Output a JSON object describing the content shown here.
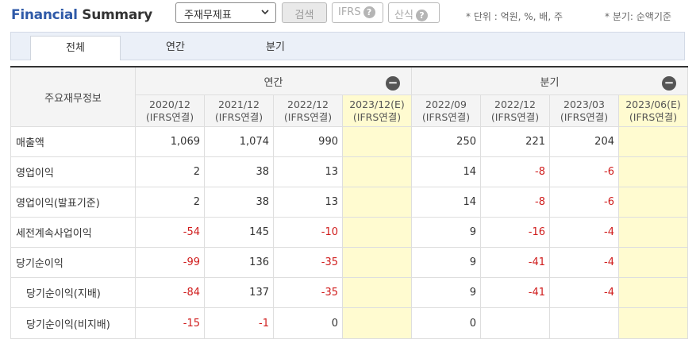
{
  "header": {
    "title_part1": "Financial",
    "title_part2": "Summary",
    "statement_select": "주재무제표",
    "search_label": "검색",
    "ifrs_label": "IFRS",
    "calc_label": "산식",
    "help_glyph": "?",
    "unit_note": "* 단위 : 억원, %, 배, 주",
    "quarter_note": "* 분기: 순액기준"
  },
  "tabs": [
    {
      "label": "전체",
      "active": true
    },
    {
      "label": "연간",
      "active": false
    },
    {
      "label": "분기",
      "active": false
    }
  ],
  "table": {
    "row_header": "주요재무정보",
    "annual_group": "연간",
    "quarter_group": "분기",
    "collapse_glyph": "−",
    "periods": [
      {
        "date": "2020/12",
        "basis": "(IFRS연결)",
        "estimate": false
      },
      {
        "date": "2021/12",
        "basis": "(IFRS연결)",
        "estimate": false
      },
      {
        "date": "2022/12",
        "basis": "(IFRS연결)",
        "estimate": false
      },
      {
        "date": "2023/12(E)",
        "basis": "(IFRS연결)",
        "estimate": true
      },
      {
        "date": "2022/09",
        "basis": "(IFRS연결)",
        "estimate": false
      },
      {
        "date": "2022/12",
        "basis": "(IFRS연결)",
        "estimate": false
      },
      {
        "date": "2023/03",
        "basis": "(IFRS연결)",
        "estimate": false
      },
      {
        "date": "2023/06(E)",
        "basis": "(IFRS연결)",
        "estimate": true
      }
    ],
    "rows": [
      {
        "label": "매출액",
        "indent": false,
        "values": [
          "1,069",
          "1,074",
          "990",
          "",
          "250",
          "221",
          "204",
          ""
        ]
      },
      {
        "label": "영업이익",
        "indent": false,
        "values": [
          "2",
          "38",
          "13",
          "",
          "14",
          "-8",
          "-6",
          ""
        ]
      },
      {
        "label": "영업이익(발표기준)",
        "indent": false,
        "values": [
          "2",
          "38",
          "13",
          "",
          "14",
          "-8",
          "-6",
          ""
        ]
      },
      {
        "label": "세전계속사업이익",
        "indent": false,
        "values": [
          "-54",
          "145",
          "-10",
          "",
          "9",
          "-16",
          "-4",
          ""
        ]
      },
      {
        "label": "당기순이익",
        "indent": false,
        "values": [
          "-99",
          "136",
          "-35",
          "",
          "9",
          "-41",
          "-4",
          ""
        ]
      },
      {
        "label": "당기순이익(지배)",
        "indent": true,
        "values": [
          "-84",
          "137",
          "-35",
          "",
          "9",
          "-41",
          "-4",
          ""
        ]
      },
      {
        "label": "당기순이익(비지배)",
        "indent": true,
        "values": [
          "-15",
          "-1",
          "0",
          "",
          "0",
          "",
          "",
          ""
        ]
      }
    ]
  },
  "colors": {
    "title_accent": "#2f5aa8",
    "negative": "#d01c1c",
    "estimate_bg": "#fffbd0",
    "tab_strip_bg": "#ebf0f8"
  }
}
